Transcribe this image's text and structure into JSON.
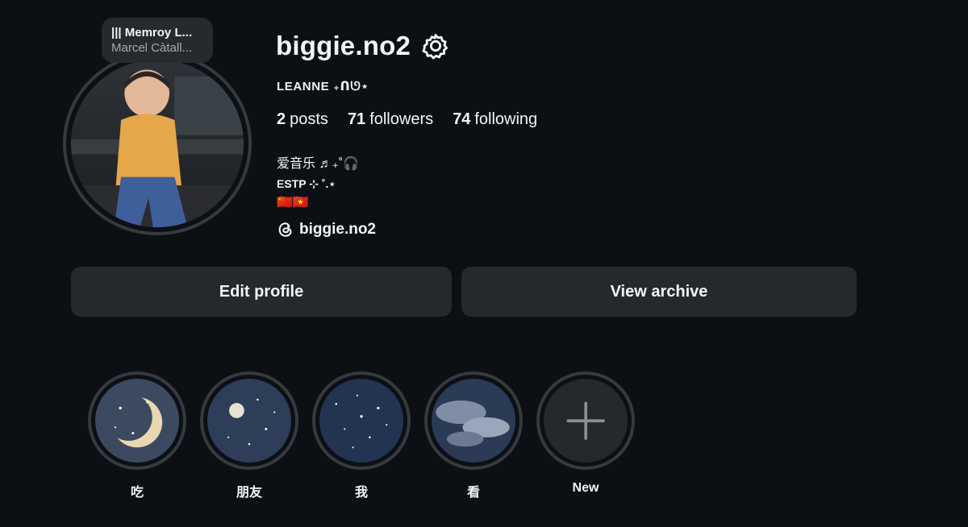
{
  "note": {
    "title": "||| Memroy L...",
    "subtitle": "Marcel Càtall..."
  },
  "profile": {
    "username": "biggie.no2",
    "display_name": "LEANNE ₊ᑎᘎ⋆",
    "stats": {
      "posts_count": "2",
      "posts_label": "posts",
      "followers_count": "71",
      "followers_label": "followers",
      "following_count": "74",
      "following_label": "following"
    },
    "bio": {
      "line1": "爱音乐 ♬₊˚🎧",
      "line2": "ESTP ⊹ ˚.⋆",
      "line3": "🇨🇳🇻🇳"
    },
    "threads_handle": "biggie.no2"
  },
  "buttons": {
    "edit_profile": "Edit profile",
    "view_archive": "View archive"
  },
  "highlights": [
    {
      "label": "吃"
    },
    {
      "label": "朋友"
    },
    {
      "label": "我"
    },
    {
      "label": "看"
    },
    {
      "label": "New"
    }
  ]
}
